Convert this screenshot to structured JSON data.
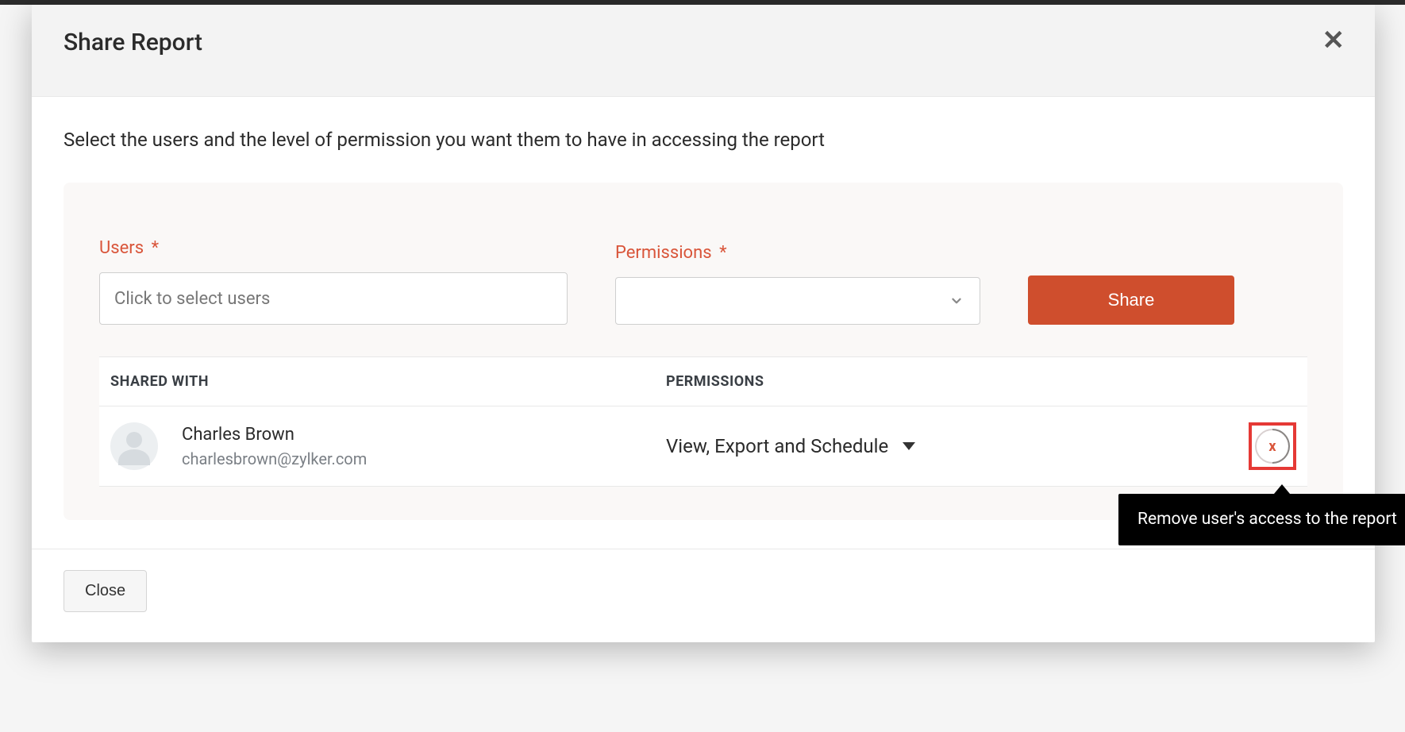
{
  "modal": {
    "title": "Share Report",
    "instruction": "Select the users and the level of permission you want them to have in accessing the report",
    "close_icon": "✕"
  },
  "form": {
    "users_label": "Users",
    "users_asterisk": "*",
    "users_placeholder": "Click to select users",
    "permissions_label": "Permissions",
    "permissions_asterisk": "*",
    "share_button": "Share"
  },
  "table": {
    "header_shared_with": "SHARED WITH",
    "header_permissions": "PERMISSIONS",
    "rows": [
      {
        "name": "Charles Brown",
        "email": "charlesbrown@zylker.com",
        "permission": "View, Export and Schedule",
        "remove_glyph": "x"
      }
    ]
  },
  "tooltip": {
    "text": "Remove user's access to the report"
  },
  "footer": {
    "close_label": "Close"
  }
}
